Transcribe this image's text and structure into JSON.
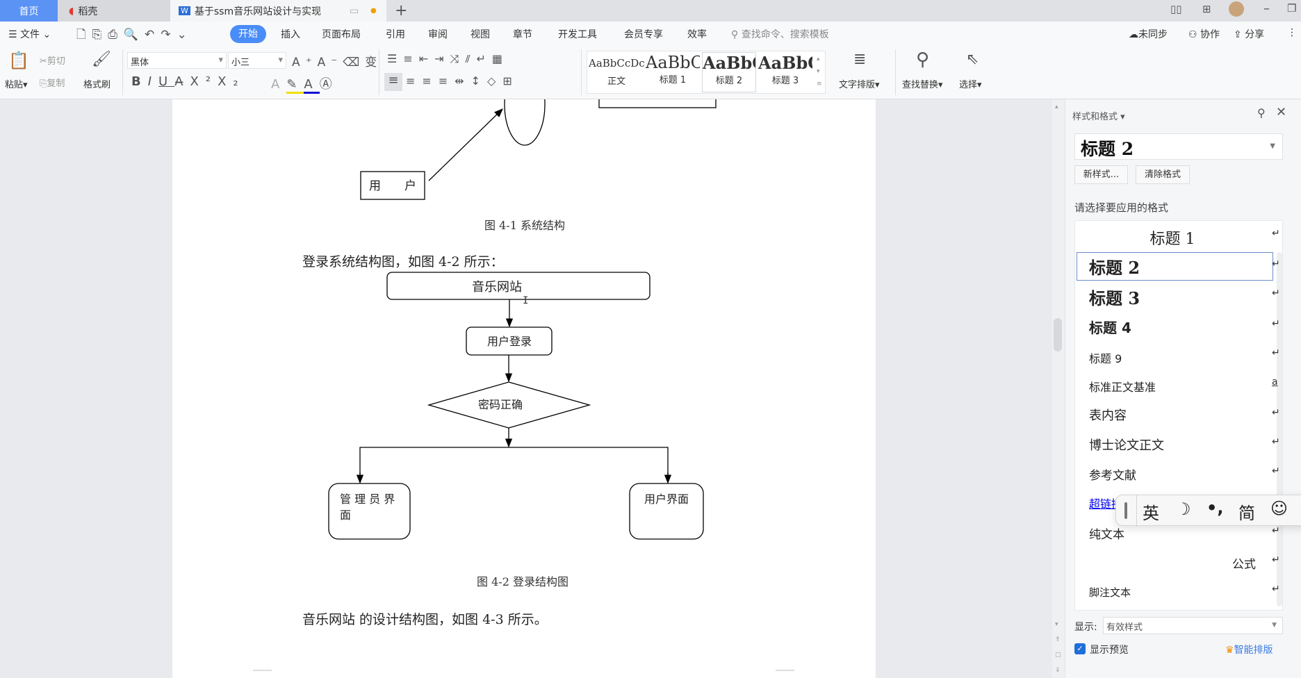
{
  "tabs": {
    "home": "首页",
    "docer": "稻壳",
    "document": "基于ssm音乐网站设计与实现",
    "new_tab": "+"
  },
  "window": {
    "icons": [
      "layout-icon",
      "grid-icon",
      "avatar",
      "minimize-icon",
      "restore-icon"
    ]
  },
  "menu": {
    "file": "文件",
    "items": [
      "开始",
      "插入",
      "页面布局",
      "引用",
      "审阅",
      "视图",
      "章节",
      "开发工具",
      "会员专享",
      "效率"
    ],
    "active": "开始",
    "search_placeholder": "查找命令、搜索模板",
    "sync": "未同步",
    "collab": "协作",
    "share": "分享"
  },
  "toolbar": {
    "paste": "粘贴",
    "cut": "剪切",
    "copy": "复制",
    "format_painter": "格式刷",
    "font_name": "黑体",
    "font_size": "小三",
    "styles": [
      {
        "preview": "AaBbCcDc",
        "label": "正文"
      },
      {
        "preview": "AaBbC",
        "label": "标题 1"
      },
      {
        "preview": "AaBbC",
        "label": "标题 2"
      },
      {
        "preview": "AaBbC",
        "label": "标题 3"
      }
    ],
    "text_layout": "文字排版",
    "find_replace": "查找替换",
    "select": "选择"
  },
  "document": {
    "fig1": {
      "user_box": "用　　户",
      "caption": "图 4-1  系统结构"
    },
    "para1": "登录系统结构图，如图 4-2 所示：",
    "fig2": {
      "root": "音乐网站",
      "login": "用户登录",
      "check": "密码正确",
      "admin": "管 理 员 界",
      "admin2": "面",
      "user": "用户界面",
      "caption": "图 4-2  登录结构图"
    },
    "para2": "音乐网站  的设计结构图，如图 4-3 所示。"
  },
  "panel": {
    "title": "样式和格式",
    "current_style": "标题  2",
    "new_style": "新样式...",
    "clear_format": "清除格式",
    "choose_label": "请选择要应用的格式",
    "styles": [
      "标题  1",
      "标题  2",
      "标题  3",
      "标题  4",
      "标题  9",
      "标准正文基准",
      "表内容",
      "博士论文正文",
      "参考文献",
      "超链接",
      "纯文本",
      "公式",
      "脚注文本"
    ],
    "selected": "标题  2",
    "show_label": "显示:",
    "show_value": "有效样式",
    "preview_label": "显示预览",
    "preview_checked": true,
    "smart_layout": "智能排版"
  },
  "ime": {
    "items": [
      "英",
      "☽",
      "•,",
      "简",
      "☺"
    ]
  },
  "colors": {
    "accent": "#4a8df8",
    "link": "#0000ee",
    "smart": "#f08c00"
  }
}
